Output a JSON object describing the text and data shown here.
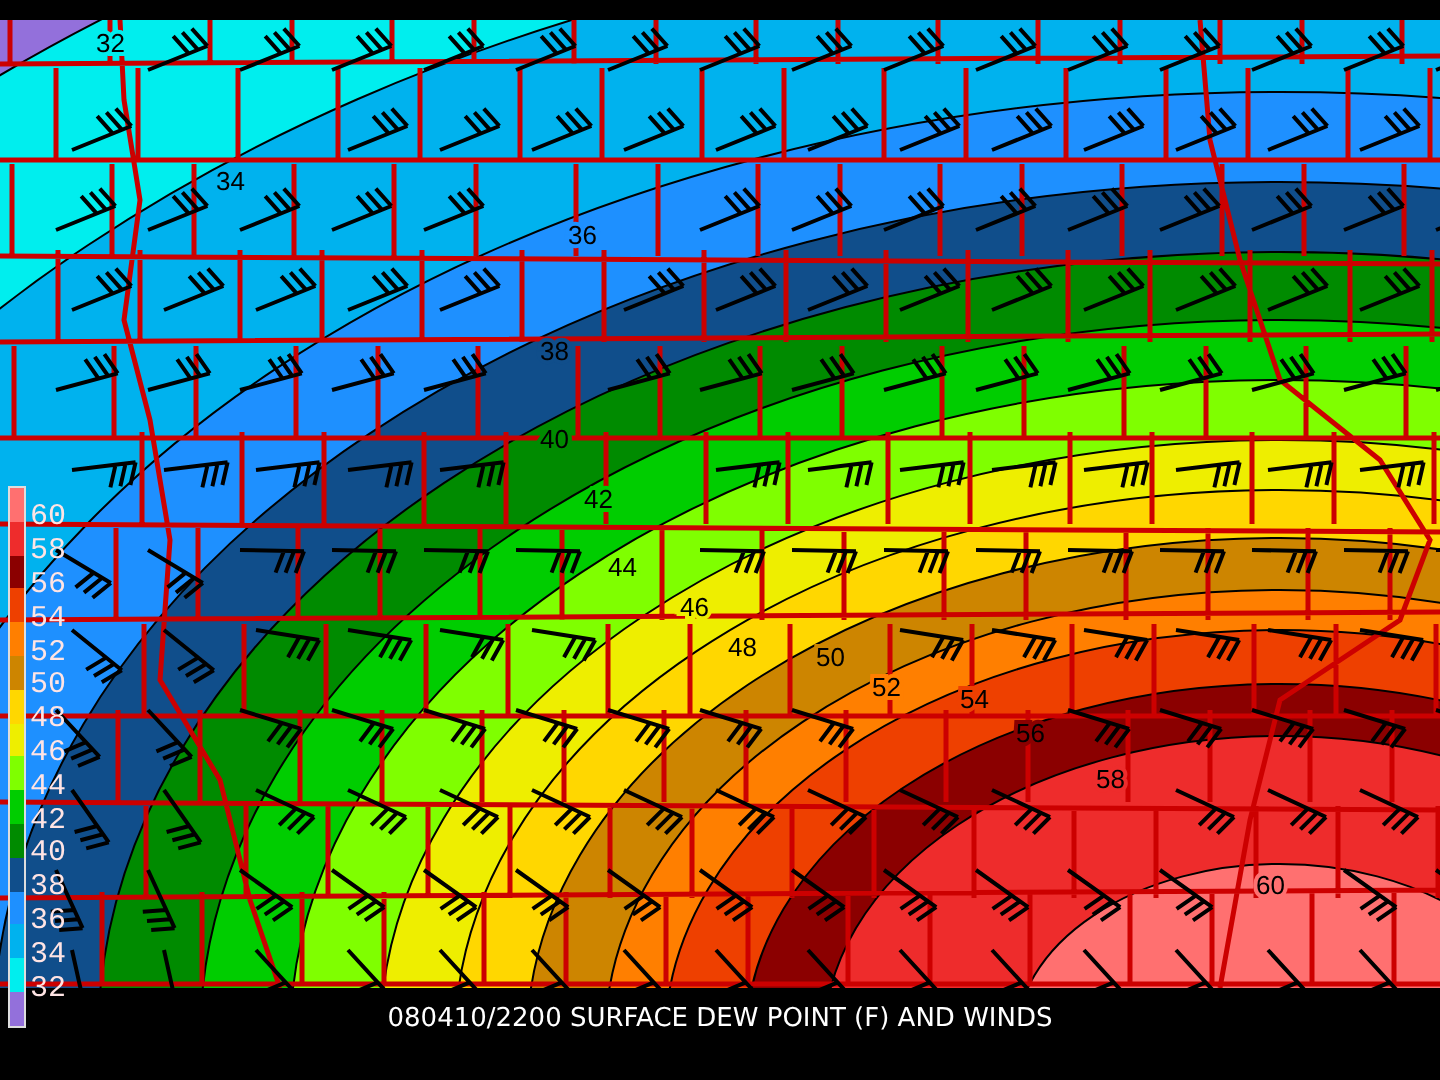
{
  "map": {
    "contour_labels": [
      "32",
      "34",
      "36",
      "38",
      "40",
      "42",
      "44",
      "46",
      "48",
      "50",
      "52",
      "54",
      "56",
      "58",
      "60"
    ]
  },
  "legend": {
    "items": [
      {
        "label": "60",
        "color": "#ff7070"
      },
      {
        "label": "58",
        "color": "#ee2c2c"
      },
      {
        "label": "56",
        "color": "#8b0000"
      },
      {
        "label": "54",
        "color": "#ee4000"
      },
      {
        "label": "52",
        "color": "#ff7f00"
      },
      {
        "label": "50",
        "color": "#cd8500"
      },
      {
        "label": "48",
        "color": "#ffd700"
      },
      {
        "label": "46",
        "color": "#eeee00"
      },
      {
        "label": "44",
        "color": "#7fff00"
      },
      {
        "label": "42",
        "color": "#00cd00"
      },
      {
        "label": "40",
        "color": "#008b00"
      },
      {
        "label": "38",
        "color": "#104e8b"
      },
      {
        "label": "36",
        "color": "#1e90ff"
      },
      {
        "label": "34",
        "color": "#00b2ee"
      },
      {
        "label": "32",
        "color": "#00eeee"
      },
      {
        "color": "#9370db"
      }
    ]
  },
  "title": "080410/2200 SURFACE DEW POINT (F) AND WINDS"
}
